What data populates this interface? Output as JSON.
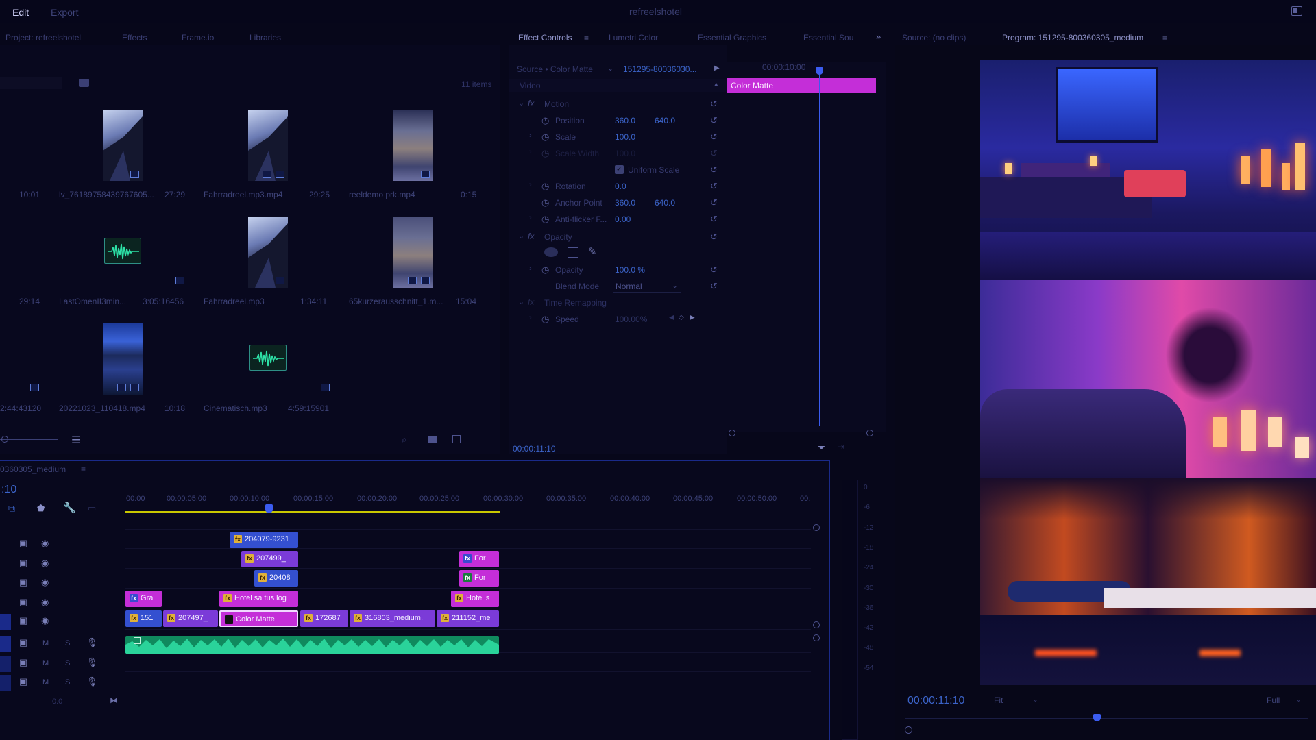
{
  "app": {
    "title": "refreelshotel",
    "menu": [
      "Edit",
      "Export"
    ]
  },
  "project_panel": {
    "tabs": [
      "Project: refreelshotel",
      "Effects",
      "Frame.io",
      "Libraries"
    ],
    "item_count": "11 items",
    "items": [
      {
        "label": "lv_76189758439767605...",
        "duration": "27:29",
        "left_duration": "10:01"
      },
      {
        "label": "Fahrradreel.mp3.mp4",
        "duration": "29:25"
      },
      {
        "label": "reeldemo prk.mp4",
        "duration": "0:15"
      },
      {
        "label": "LastOmenII3min...",
        "duration": "3:05:16456",
        "left_duration": "29:14"
      },
      {
        "label": "Fahrradreel.mp3",
        "duration": "1:34:11"
      },
      {
        "label": "65kurzerausschnitt_1.m...",
        "duration": "15:04"
      },
      {
        "label": "20221023_110418.mp4",
        "duration": "10:18",
        "left_duration": "2:44:43120"
      },
      {
        "label": "Cinematisch.mp3",
        "duration": "4:59:15901"
      }
    ]
  },
  "effect_controls": {
    "tabs": [
      "Effect Controls",
      "Lumetri Color",
      "Essential Graphics",
      "Essential Sou"
    ],
    "source_label": "Source • Color Matte",
    "sequence_label": "151295-80036030...",
    "video_label": "Video",
    "motion": "Motion",
    "params": [
      {
        "name": "Position",
        "v1": "360.0",
        "v2": "640.0"
      },
      {
        "name": "Scale",
        "v1": "100.0",
        "v2": ""
      },
      {
        "name": "Scale Width",
        "v1": "100.0",
        "v2": ""
      },
      {
        "name": "Uniform Scale",
        "v1": "",
        "v2": ""
      },
      {
        "name": "Rotation",
        "v1": "0.0",
        "v2": ""
      },
      {
        "name": "Anchor Point",
        "v1": "360.0",
        "v2": "640.0"
      },
      {
        "name": "Anti-flicker F...",
        "v1": "0.00",
        "v2": ""
      }
    ],
    "opacity_section": "Opacity",
    "opacity_param": "Opacity",
    "opacity_value": "100.0 %",
    "blend_mode_label": "Blend Mode",
    "blend_mode_value": "Normal",
    "time_remap": "Time Remapping",
    "speed_label": "Speed",
    "speed_value": "100.00%",
    "mini_timecode": "00:00:10:00",
    "clip_bar_label": "Color Matte",
    "timecode": "00:00:11:10"
  },
  "source_monitor": {
    "tab": "Source: (no clips)"
  },
  "program_monitor": {
    "tab": "Program: 151295-800360305_medium",
    "timecode": "00:00:11:10",
    "fit": "Fit",
    "resolution": "Full"
  },
  "timeline": {
    "sequence_name": "0360305_medium",
    "timecode_short": ":10",
    "ruler": [
      "00:00",
      "00:00:05:00",
      "00:00:10:00",
      "00:00:15:00",
      "00:00:20:00",
      "00:00:25:00",
      "00:00:30:00",
      "00:00:35:00",
      "00:00:40:00",
      "00:00:45:00",
      "00:00:50:00",
      "00:"
    ],
    "clips": {
      "v5_a": "204079-9231",
      "v4_a": "207499_",
      "v4_b": "For",
      "v3_a": "20408",
      "v3_b": "For",
      "v2_a": "Gra",
      "v2_b": "Hotel sa tus log",
      "v2_c": "Hotel s",
      "v1_a": "151",
      "v1_b": "207497_",
      "v1_c": "Color Matte",
      "v1_d": "172687",
      "v1_e": "316803_medium.",
      "v1_f": "211152_me"
    },
    "audio_mute": "M",
    "audio_solo": "S",
    "master_level": "0.0",
    "meter_scale": [
      "0",
      "-6",
      "-12",
      "-18",
      "-24",
      "-30",
      "-36",
      "-42",
      "-48",
      "-54"
    ]
  },
  "colors": {
    "accent": "#3b63c8",
    "clip_pink": "#c42ed8",
    "clip_purple": "#7b3bd8",
    "clip_blue": "#3450d0",
    "audio_green": "#22c08a",
    "playhead": "#3b5cf0"
  }
}
